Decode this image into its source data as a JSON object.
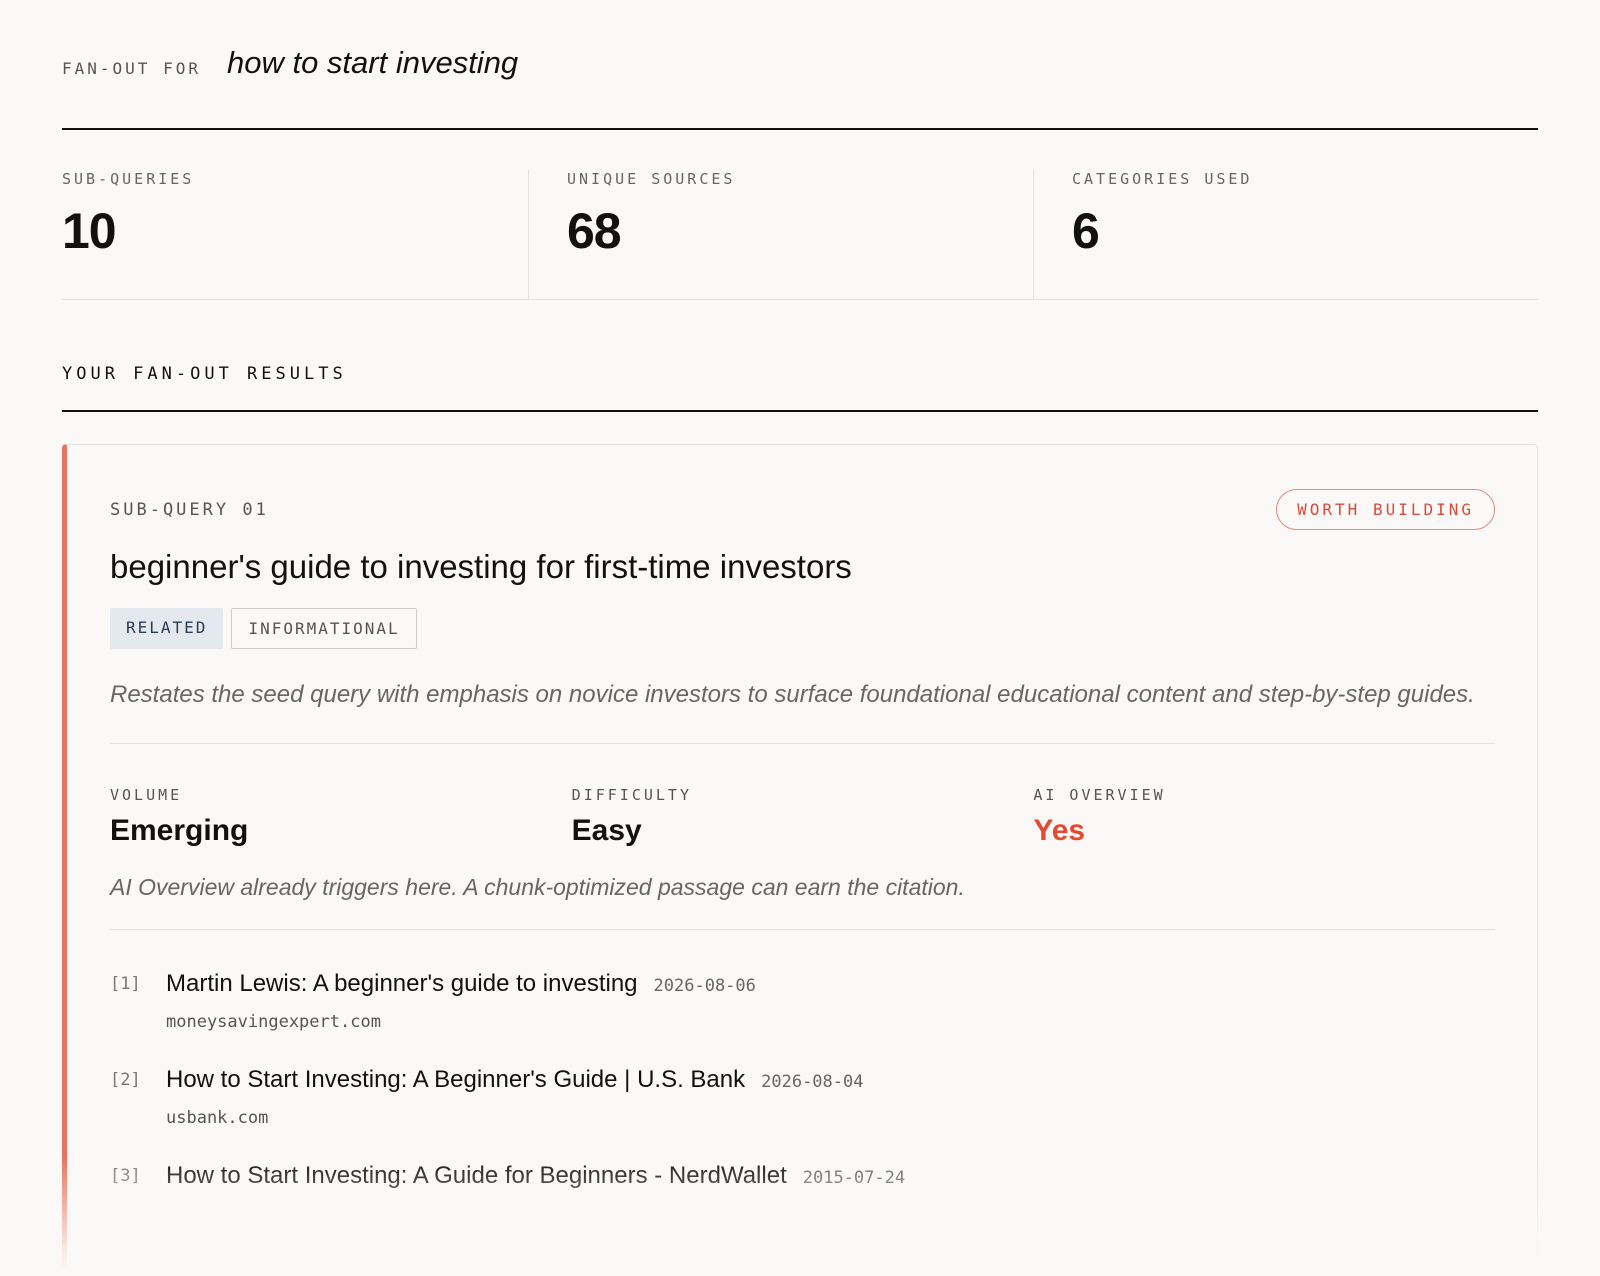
{
  "header": {
    "label": "FAN-OUT FOR",
    "query": "how to start investing"
  },
  "stats": [
    {
      "label": "SUB-QUERIES",
      "value": "10"
    },
    {
      "label": "UNIQUE SOURCES",
      "value": "68"
    },
    {
      "label": "CATEGORIES USED",
      "value": "6"
    }
  ],
  "results_heading": "YOUR FAN-OUT RESULTS",
  "card": {
    "number_label": "SUB-QUERY 01",
    "badge": "WORTH BUILDING",
    "title": "beginner's guide to investing for first-time investors",
    "tags": [
      "RELATED",
      "INFORMATIONAL"
    ],
    "description": "Restates the seed query with emphasis on novice investors to surface foundational educational content and step-by-step guides.",
    "metrics": [
      {
        "label": "VOLUME",
        "value": "Emerging"
      },
      {
        "label": "DIFFICULTY",
        "value": "Easy"
      },
      {
        "label": "AI OVERVIEW",
        "value": "Yes"
      }
    ],
    "note": "AI Overview already triggers here. A chunk-optimized passage can earn the citation.",
    "sources": [
      {
        "index": "[1]",
        "title": "Martin Lewis: A beginner's guide to investing",
        "date": "2026-08-06",
        "domain": "moneysavingexpert.com"
      },
      {
        "index": "[2]",
        "title": "How to Start Investing: A Beginner's Guide | U.S. Bank",
        "date": "2026-08-04",
        "domain": "usbank.com"
      },
      {
        "index": "[3]",
        "title": "How to Start Investing: A Guide for Beginners - NerdWallet",
        "date": "2015-07-24",
        "domain": ""
      }
    ]
  },
  "colors": {
    "accent": "#e9735e",
    "badge": "#d44d3a",
    "yes": "#e24a33",
    "related_tag_bg": "#e4e9f0"
  }
}
